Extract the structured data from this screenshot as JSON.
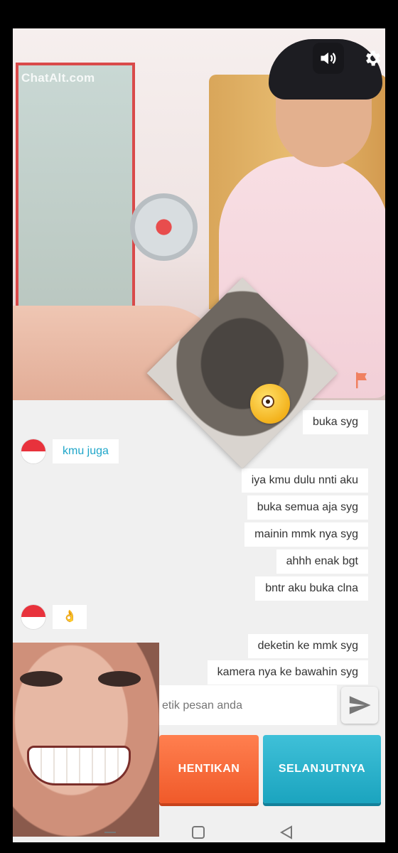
{
  "app": {
    "watermark": "ChatAlt.com"
  },
  "controls": {
    "volume_icon": "speaker-icon",
    "settings_icon": "gear-icon",
    "report_icon": "flag-icon"
  },
  "messages": [
    {
      "side": "right",
      "text": "buka syg"
    },
    {
      "side": "left",
      "text": "kmu juga",
      "flag": "indonesia"
    },
    {
      "side": "right",
      "text": "iya kmu dulu nnti aku"
    },
    {
      "side": "right",
      "text": "buka semua aja syg"
    },
    {
      "side": "right",
      "text": "mainin mmk nya syg"
    },
    {
      "side": "right",
      "text": "ahhh enak bgt"
    },
    {
      "side": "right",
      "text": "bntr aku buka clna"
    },
    {
      "side": "left",
      "text": "👌",
      "flag": "indonesia"
    },
    {
      "side": "right",
      "text": "deketin ke mmk syg"
    },
    {
      "side": "right",
      "text": "kamera nya ke bawahin syg"
    }
  ],
  "input": {
    "placeholder": "etik pesan anda"
  },
  "buttons": {
    "stop": "HENTIKAN",
    "next": "SELANJUTNYA"
  },
  "colors": {
    "stop": "#f05a2a",
    "next": "#1ba4bf",
    "accent_text": "#1fa6c9"
  }
}
